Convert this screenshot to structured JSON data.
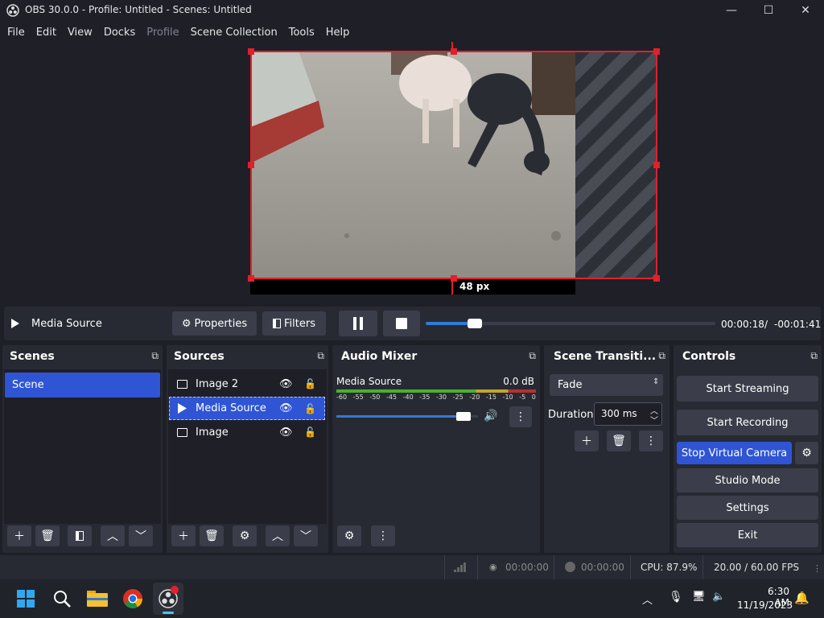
{
  "window": {
    "title": "OBS 30.0.0 - Profile: Untitled - Scenes: Untitled",
    "minimize": "—",
    "maximize": "☐",
    "close": "✕"
  },
  "menu": [
    "File",
    "Edit",
    "View",
    "Docks",
    "Profile",
    "Scene Collection",
    "Tools",
    "Help"
  ],
  "preview": {
    "size_label": "48 px"
  },
  "media_bar": {
    "source_name": "Media Source",
    "properties_label": "Properties",
    "filters_label": "Filters",
    "elapsed": "00:00:18",
    "separator": "/",
    "remaining": "-00:01:41",
    "progress": 0.17
  },
  "scenes": {
    "title": "Scenes",
    "items": [
      "Scene"
    ]
  },
  "sources": {
    "title": "Sources",
    "items": [
      {
        "name": "Image 2"
      },
      {
        "name": "Media Source"
      },
      {
        "name": "Image"
      }
    ]
  },
  "audio_mixer": {
    "title": "Audio Mixer",
    "source": "Media Source",
    "level": "0.0 dB",
    "ticks": [
      "-60",
      "-55",
      "-50",
      "-45",
      "-40",
      "-35",
      "-30",
      "-25",
      "-20",
      "-15",
      "-10",
      "-5",
      "0"
    ],
    "volume": 0.95
  },
  "transitions": {
    "title": "Scene Transiti...",
    "selected": "Fade",
    "duration_label": "Duration",
    "duration_value": "300 ms"
  },
  "controls": {
    "title": "Controls",
    "start_streaming": "Start Streaming",
    "start_recording": "Start Recording",
    "virtual_camera": "Stop Virtual Camera",
    "studio_mode": "Studio Mode",
    "settings": "Settings",
    "exit": "Exit"
  },
  "status": {
    "stream_time": "00:00:00",
    "record_time": "00:00:00",
    "cpu": "CPU: 87.9%",
    "fps": "20.00 / 60.00 FPS"
  },
  "taskbar": {
    "time": "6:30 AM",
    "date": "11/19/2023"
  },
  "colors": {
    "accent": "#2f55d4",
    "selection": "#e0202d",
    "background": "#1e1f27",
    "panel": "#272a33",
    "button": "#3b3e4a"
  }
}
